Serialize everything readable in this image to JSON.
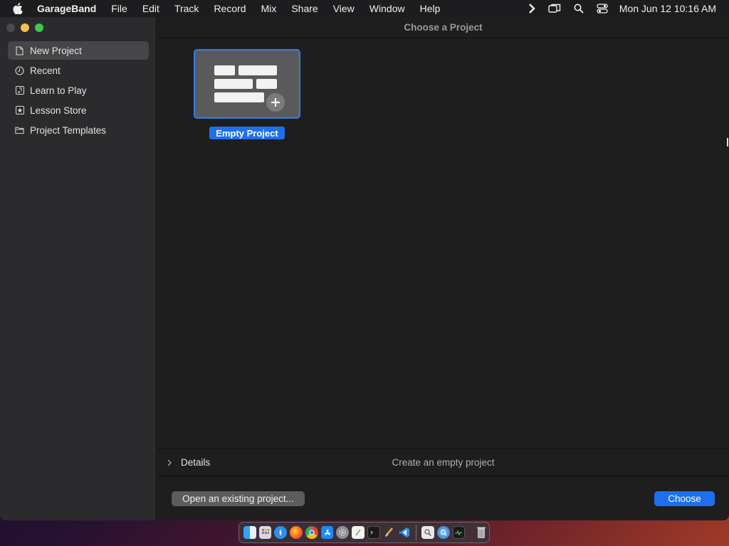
{
  "menubar": {
    "app_name": "GarageBand",
    "items": [
      "File",
      "Edit",
      "Track",
      "Record",
      "Mix",
      "Share",
      "View",
      "Window",
      "Help"
    ],
    "clock": "Mon Jun 12  10:16 AM"
  },
  "window": {
    "title": "Choose a Project"
  },
  "sidebar": {
    "items": [
      {
        "label": "New Project",
        "icon": "document-icon",
        "selected": true
      },
      {
        "label": "Recent",
        "icon": "clock-icon"
      },
      {
        "label": "Learn to Play",
        "icon": "music-note-icon"
      },
      {
        "label": "Lesson Store",
        "icon": "star-icon"
      },
      {
        "label": "Project Templates",
        "icon": "folder-icon"
      }
    ]
  },
  "projects": [
    {
      "label": "Empty Project",
      "selected": true
    }
  ],
  "details": {
    "label": "Details",
    "description": "Create an empty project"
  },
  "footer": {
    "open_label": "Open an existing project...",
    "choose_label": "Choose"
  },
  "dock": {
    "apps": [
      "finder-icon",
      "launchpad-icon",
      "safari-icon",
      "firefox-icon",
      "chrome-icon",
      "app-store-icon",
      "settings-icon",
      "notes-icon",
      "terminal-icon",
      "brush-icon",
      "vscode-icon"
    ],
    "others": [
      "preview-icon",
      "quicktime-icon",
      "activity-monitor-icon",
      "trash-icon"
    ]
  },
  "colors": {
    "accent": "#1e6ff0",
    "sidebar_bg": "#2b2b2d",
    "content_bg": "#1e1e1e"
  }
}
